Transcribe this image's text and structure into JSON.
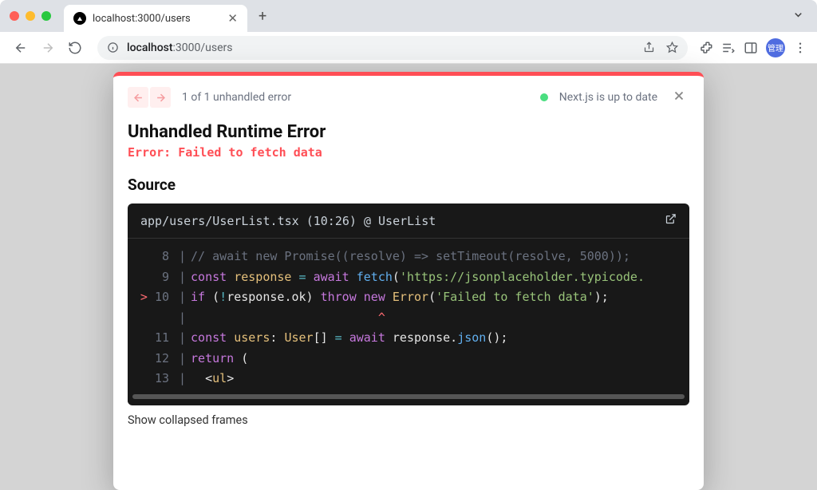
{
  "browser": {
    "tab_title": "localhost:3000/users",
    "url_host": "localhost",
    "url_port_path": ":3000/users",
    "avatar_label": "管理"
  },
  "dialog": {
    "pager_text": "1 of 1 unhandled error",
    "status_text": "Next.js is up to date",
    "title": "Unhandled Runtime Error",
    "message": "Error: Failed to fetch data",
    "section_label": "Source",
    "source_header": "app/users/UserList.tsx (10:26) @ UserList",
    "collapsed_link": "Show collapsed frames"
  },
  "code": {
    "lines": [
      {
        "num": "8",
        "hl": false,
        "html": "<span class='c-comment'>// await new Promise((resolve) =&gt; setTimeout(resolve, 5000));</span>"
      },
      {
        "num": "9",
        "hl": false,
        "html": "<span class='c-kw'>const</span> <span class='c-def'>response</span> <span class='c-op'>=</span> <span class='c-kw'>await</span> <span class='c-fn'>fetch</span><span class='c-punc'>(</span><span class='c-str'>'https://jsonplaceholder.typicode.</span>"
      },
      {
        "num": "10",
        "hl": true,
        "html": "<span class='c-kw'>if</span> <span class='c-punc'>(</span><span class='c-op'>!</span><span class='c-var'>response</span><span class='c-punc'>.</span><span class='c-var'>ok</span><span class='c-punc'>)</span> <span class='c-kw'>throw</span> <span class='c-kw'>new</span> <span class='c-type'>Error</span><span class='c-punc'>(</span><span class='c-str'>'Failed to fetch data'</span><span class='c-punc'>);</span>"
      },
      {
        "num": "",
        "hl": false,
        "caret": true,
        "html": "                          <span class='caret'>^</span>"
      },
      {
        "num": "11",
        "hl": false,
        "html": "<span class='c-kw'>const</span> <span class='c-def'>users</span><span class='c-punc'>:</span> <span class='c-type'>User</span><span class='c-punc'>[]</span> <span class='c-op'>=</span> <span class='c-kw'>await</span> <span class='c-var'>response</span><span class='c-punc'>.</span><span class='c-fn'>json</span><span class='c-punc'>();</span>"
      },
      {
        "num": "12",
        "hl": false,
        "html": "<span class='c-kw'>return</span> <span class='c-punc'>(</span>"
      },
      {
        "num": "13",
        "hl": false,
        "html": "  <span class='c-punc'>&lt;</span><span class='c-type'>ul</span><span class='c-punc'>&gt;</span>"
      }
    ]
  }
}
